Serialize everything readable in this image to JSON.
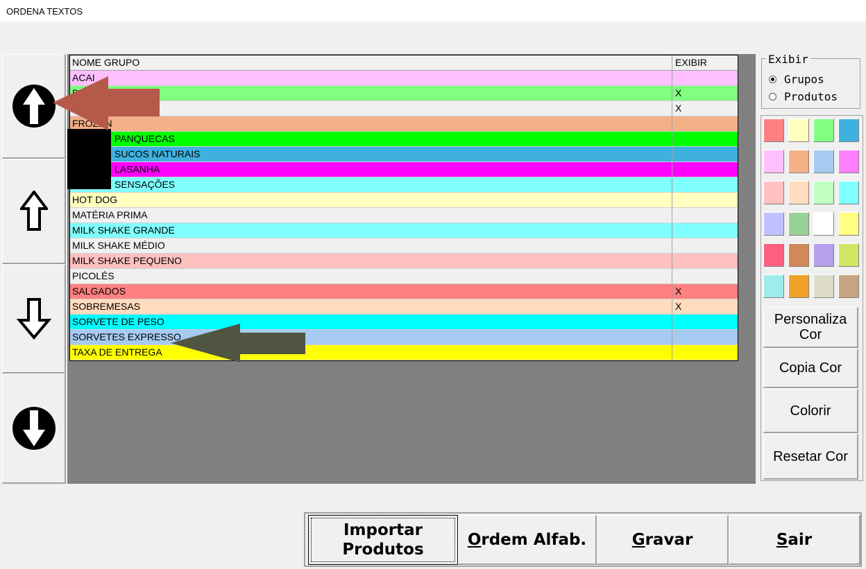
{
  "window": {
    "title": "ORDENA TEXTOS"
  },
  "nav": {
    "move_top_icon": "arrow-top-filled-icon",
    "move_up_icon": "arrow-up-outline-icon",
    "move_down_icon": "arrow-down-outline-icon",
    "move_bottom_icon": "arrow-bottom-filled-icon"
  },
  "grid": {
    "headers": [
      "NOME GRUPO",
      "EXIBIR"
    ],
    "rows": [
      {
        "name": "ACAI",
        "exibir": "",
        "color": "#ffbfff"
      },
      {
        "name": "BEBIDAS",
        "exibir": "X",
        "color": "#80ff80"
      },
      {
        "name": "",
        "exibir": "X",
        "color": "#f0f0f0"
      },
      {
        "name": "FROZEN",
        "exibir": "",
        "color": "#f4b087"
      },
      {
        "name": "PANQUECAS",
        "exibir": "",
        "color": "#00ff00"
      },
      {
        "name": "SUCOS NATURAIS",
        "exibir": "",
        "color": "#3fb1e0"
      },
      {
        "name": "LASANHA",
        "exibir": "",
        "color": "#ff00ff"
      },
      {
        "name": "SENSAÇÕES",
        "exibir": "",
        "color": "#80ffff"
      },
      {
        "name": "HOT DOG",
        "exibir": "",
        "color": "#ffffc0"
      },
      {
        "name": "MATÉRIA PRIMA",
        "exibir": "",
        "color": "#f0f0f0"
      },
      {
        "name": "MILK SHAKE GRANDE",
        "exibir": "",
        "color": "#80ffff"
      },
      {
        "name": "MILK SHAKE MÉDIO",
        "exibir": "",
        "color": "#f0f0f0"
      },
      {
        "name": "MILK SHAKE PEQUENO",
        "exibir": "",
        "color": "#ffc0c0"
      },
      {
        "name": "PICOLÉS",
        "exibir": "",
        "color": "#f0f0f0"
      },
      {
        "name": "SALGADOS",
        "exibir": "X",
        "color": "#ff8080"
      },
      {
        "name": "SOBREMESAS",
        "exibir": "X",
        "color": "#ffdcbe"
      },
      {
        "name": "SORVETE DE PESO",
        "exibir": "",
        "color": "#00ffff"
      },
      {
        "name": "SORVETES EXPRESSO",
        "exibir": "",
        "color": "#a6caf0"
      },
      {
        "name": "TAXA DE ENTREGA",
        "exibir": "",
        "color": "#ffff00"
      }
    ]
  },
  "exibir": {
    "legend": "Exibir",
    "options": [
      {
        "label": "Grupos",
        "selected": true
      },
      {
        "label": "Produtos",
        "selected": false
      }
    ]
  },
  "palette": {
    "colors": [
      "#ff8080",
      "#ffffc0",
      "#80ff80",
      "#3fb1e0",
      "#ffbfff",
      "#f4b087",
      "#a6caf0",
      "#ff80ff",
      "#ffc0c0",
      "#ffdcbe",
      "#c0ffc0",
      "#80ffff",
      "#c0c0ff",
      "#96d296",
      "#ffffff",
      "#ffff80",
      "#ff6080",
      "#d2895a",
      "#b4a0eb",
      "#d2e664",
      "#a0ebeb",
      "#f0a028",
      "#dcdcc8",
      "#c8a582"
    ]
  },
  "side_buttons": {
    "personaliza": "Personaliza Cor",
    "copia": "Copia Cor",
    "colorir": "Colorir",
    "resetar": "Resetar Cor"
  },
  "bottom_buttons": {
    "importar": "Importar Produtos",
    "ordem_mnemonic": "O",
    "ordem_rest": "rdem Alfab.",
    "gravar_mnemonic": "G",
    "gravar_rest": "ravar",
    "sair_mnemonic": "S",
    "sair_rest": "air"
  },
  "annotations": {
    "red_arrow_color": "#b55a4b",
    "green_arrow_color": "#4f5541"
  }
}
